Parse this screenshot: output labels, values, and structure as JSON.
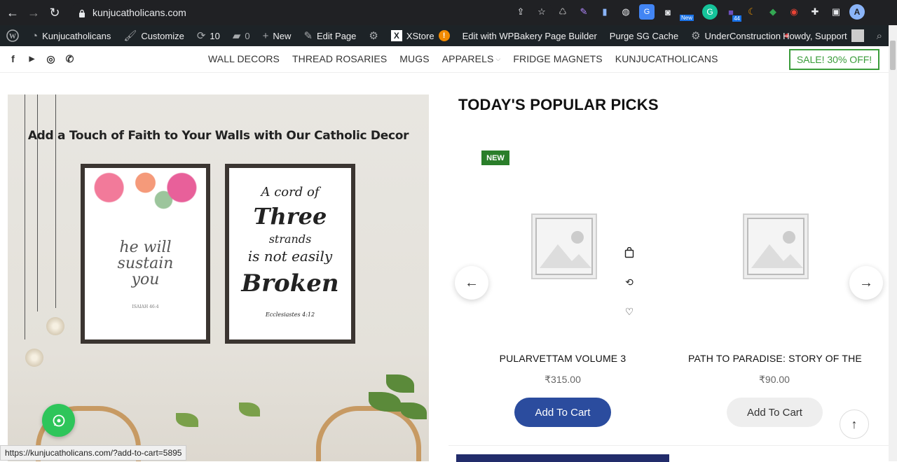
{
  "browser": {
    "url": "kunjucatholicans.com",
    "ext_badge_new": "New",
    "ext_badge_count": "44",
    "profile_initial": "A"
  },
  "adminbar": {
    "site_name": "Kunjucatholicans",
    "customize": "Customize",
    "updates": "10",
    "comments": "0",
    "new": "New",
    "edit_page": "Edit Page",
    "xstore": "XStore",
    "xstore_badge": "!",
    "wpbakery": "Edit with WPBakery Page Builder",
    "purge": "Purge SG Cache",
    "under_construction": "UnderConstruction",
    "howdy": "Howdy, Support"
  },
  "header": {
    "nav": [
      "WALL DECORS",
      "THREAD ROSARIES",
      "MUGS",
      "APPARELS",
      "FRIDGE MAGNETS",
      "KUNJUCATHOLICANS"
    ],
    "sale": "SALE! 30% OFF!"
  },
  "hero": {
    "headline": "Add a Touch of Faith to Your Walls with Our Catholic Decor",
    "frame1_text": "he will sustain you",
    "frame1_ref": "ISAIAH 46:4",
    "frame2_text_a": "A cord of",
    "frame2_text_b": "Three",
    "frame2_text_c": "strands",
    "frame2_text_d": "is not easily",
    "frame2_text_e": "Broken",
    "frame2_ref": "Ecclesiastes 4:12"
  },
  "popular": {
    "title": "TODAY'S POPULAR PICKS",
    "badge": "NEW",
    "products": [
      {
        "title": "PULARVETTAM VOLUME 3",
        "price": "₹315.00",
        "cta": "Add To Cart"
      },
      {
        "title": "PATH TO PARADISE: STORY OF THE",
        "price": "₹90.00",
        "cta": "Add To Cart"
      }
    ]
  },
  "status_url": "https://kunjucatholicans.com/?add-to-cart=5895"
}
